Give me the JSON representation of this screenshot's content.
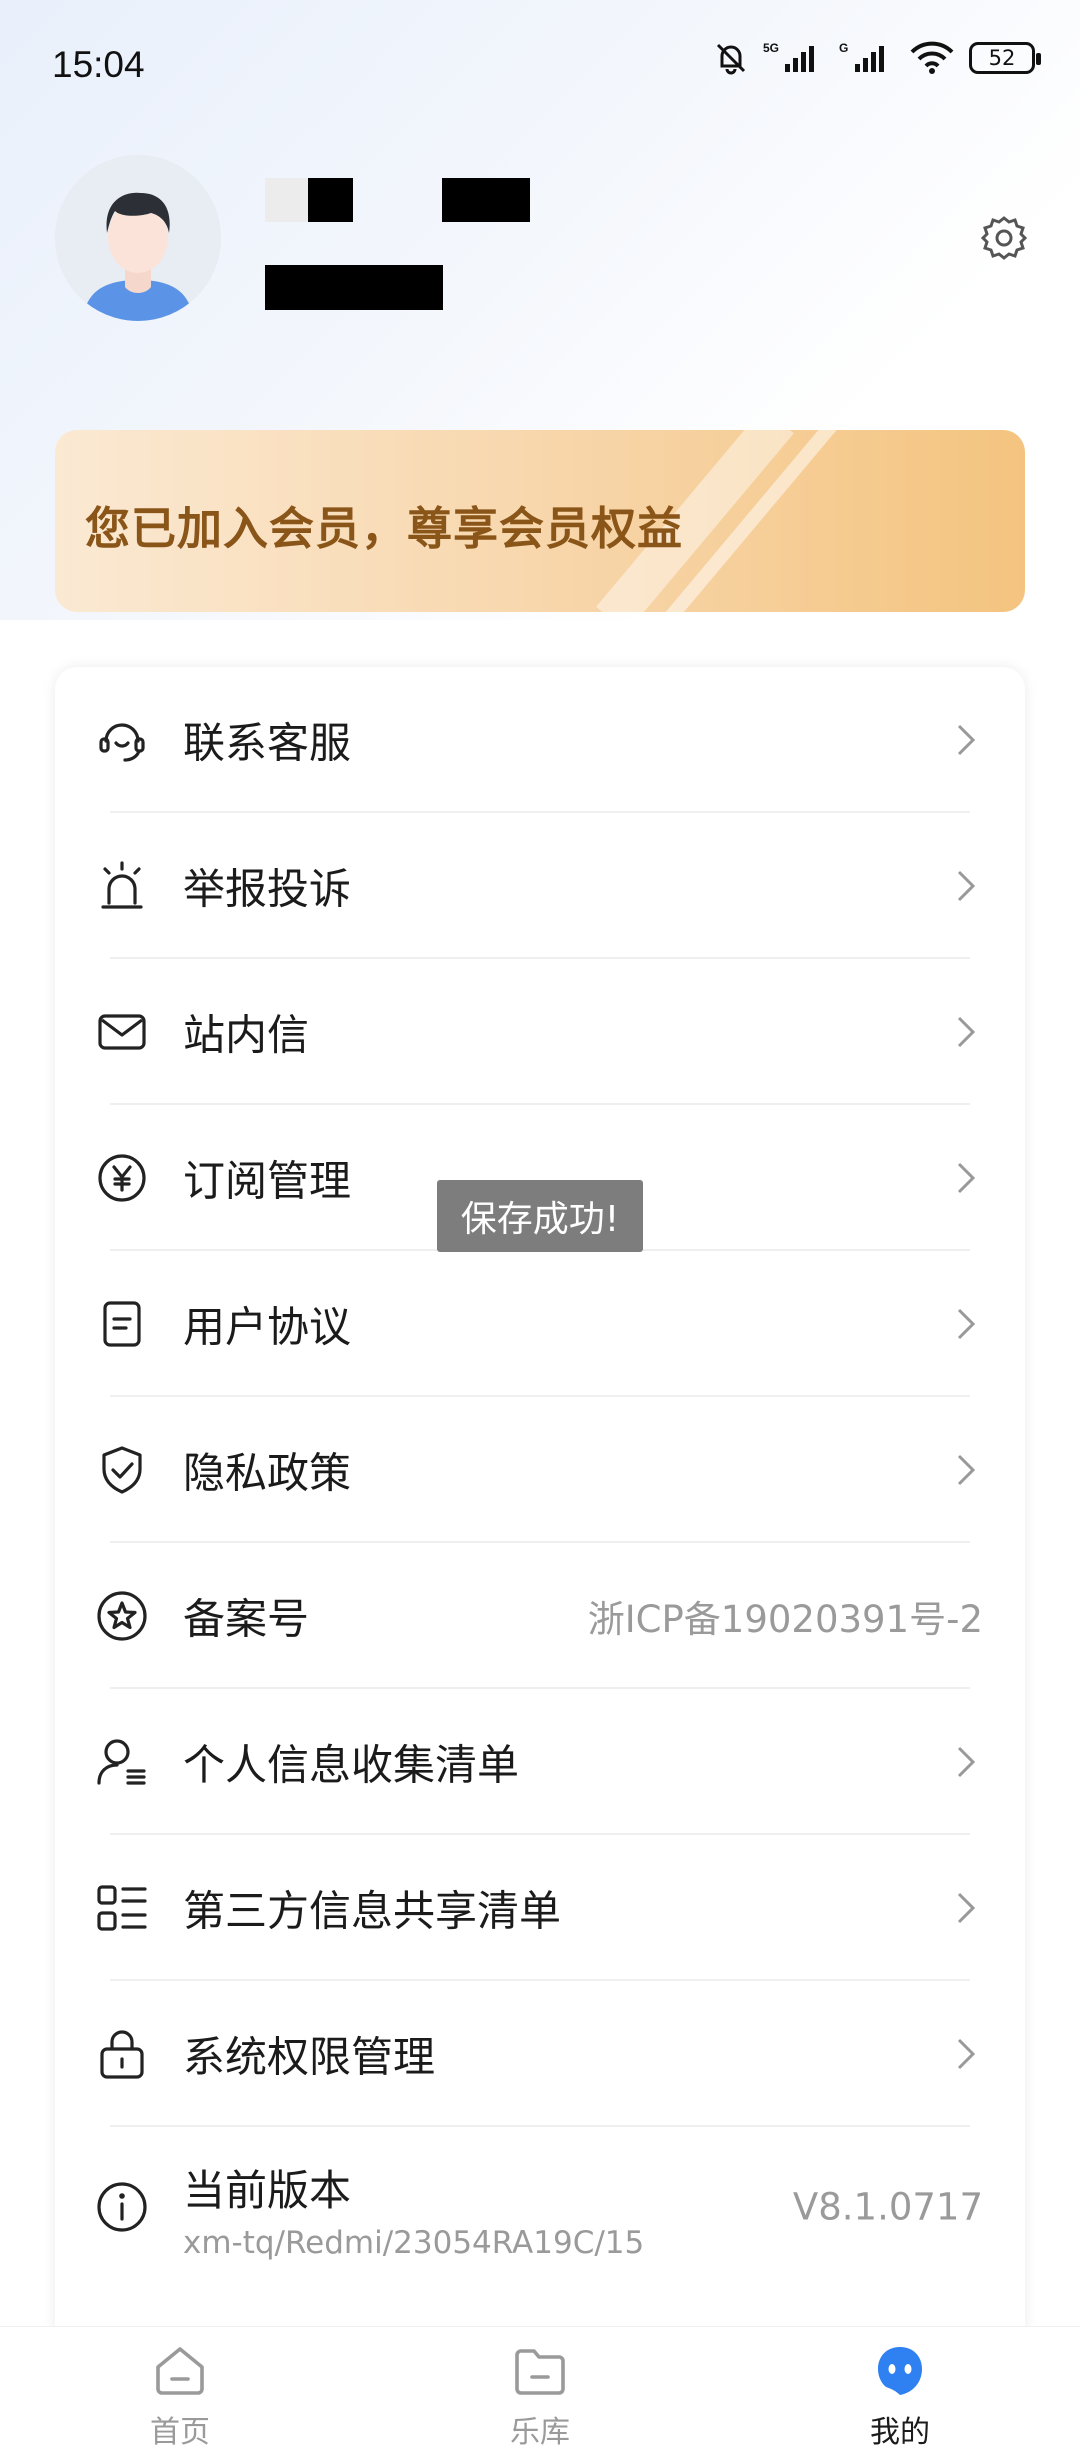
{
  "status_bar": {
    "time": "15:04",
    "battery": "52"
  },
  "profile": {
    "avatar": "avatar-icon",
    "settings_icon": "gear-icon"
  },
  "vip_banner": {
    "text": "您已加入会员，尊享会员权益",
    "color": "#8a5518"
  },
  "menu": {
    "items": [
      {
        "label": "联系客服",
        "icon": "headset-icon"
      },
      {
        "label": "举报投诉",
        "icon": "alarm-icon"
      },
      {
        "label": "站内信",
        "icon": "mail-icon"
      },
      {
        "label": "订阅管理",
        "icon": "yen-icon"
      },
      {
        "label": "用户协议",
        "icon": "document-icon"
      },
      {
        "label": "隐私政策",
        "icon": "shield-icon"
      },
      {
        "label": "备案号",
        "icon": "star-icon",
        "value": "浙ICP备19020391号-2"
      },
      {
        "label": "个人信息收集清单",
        "icon": "user-list-icon"
      },
      {
        "label": "第三方信息共享清单",
        "icon": "list-icon"
      },
      {
        "label": "系统权限管理",
        "icon": "lock-icon"
      },
      {
        "label": "当前版本",
        "icon": "info-icon",
        "sub": "xm-tq/Redmi/23054RA19C/15",
        "value": "V8.1.0717"
      }
    ]
  },
  "toast": {
    "text": "保存成功!"
  },
  "tabbar": {
    "tabs": [
      {
        "label": "首页",
        "icon": "home-icon"
      },
      {
        "label": "乐库",
        "icon": "folder-icon"
      },
      {
        "label": "我的",
        "icon": "mine-icon"
      }
    ],
    "active_color": "#2f80f0"
  }
}
